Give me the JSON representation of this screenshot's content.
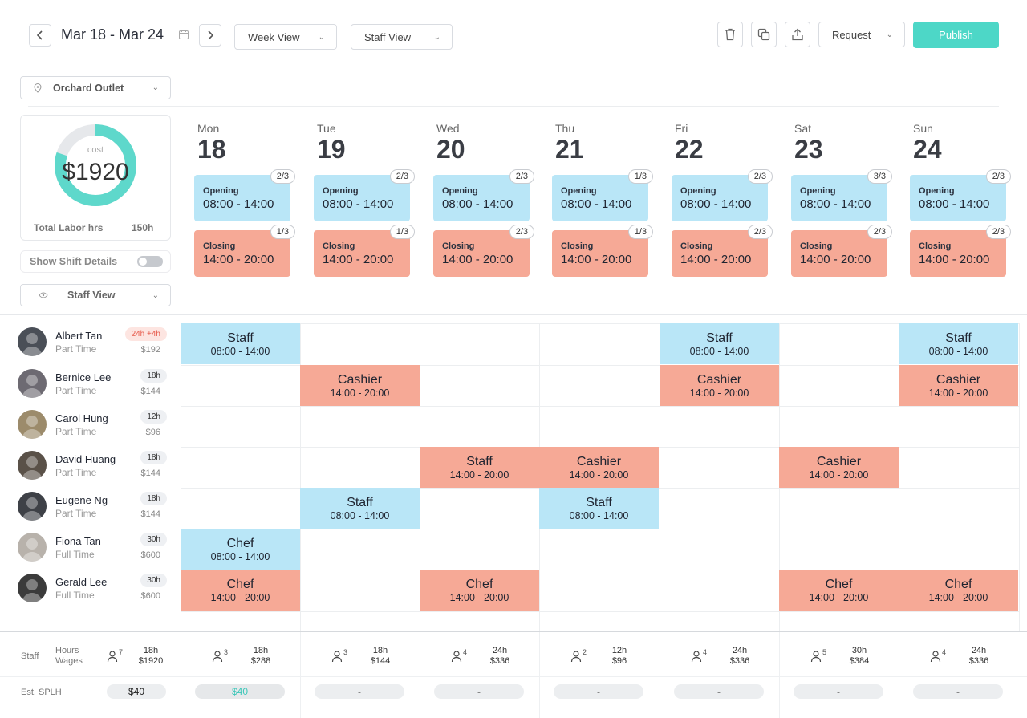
{
  "toolbar": {
    "date_range": "Mar 18 - Mar 24",
    "view_select": "Week View",
    "mode_select": "Staff View",
    "request_label": "Request",
    "publish_label": "Publish",
    "icons": [
      "chevron-left-icon",
      "chevron-right-icon",
      "calendar-icon",
      "trash-icon",
      "copy-icon",
      "share-icon"
    ]
  },
  "location": "Orchard Outlet",
  "summary": {
    "cost_label": "cost",
    "cost_value": "$1920",
    "cost_ring_fraction": 0.8,
    "total_hrs_label": "Total Labor hrs",
    "total_hrs_value": "150h",
    "toggle_label": "Show Shift Details",
    "toggle_on": false,
    "view_select": "Staff View"
  },
  "colors": {
    "opening": "#b9e6f7",
    "closing": "#f6a996",
    "accent": "#4dd7c7",
    "warn": "#e65a4b"
  },
  "days": [
    {
      "name": "Mon",
      "num": "18",
      "open_badge": "2/3",
      "close_badge": "1/3"
    },
    {
      "name": "Tue",
      "num": "19",
      "open_badge": "2/3",
      "close_badge": "1/3"
    },
    {
      "name": "Wed",
      "num": "20",
      "open_badge": "2/3",
      "close_badge": "2/3"
    },
    {
      "name": "Thu",
      "num": "21",
      "open_badge": "1/3",
      "close_badge": "1/3"
    },
    {
      "name": "Fri",
      "num": "22",
      "open_badge": "2/3",
      "close_badge": "2/3"
    },
    {
      "name": "Sat",
      "num": "23",
      "open_badge": "3/3",
      "close_badge": "2/3"
    },
    {
      "name": "Sun",
      "num": "24",
      "open_badge": "2/3",
      "close_badge": "2/3"
    }
  ],
  "shift_types": {
    "opening": {
      "label": "Opening",
      "time": "08:00 - 14:00"
    },
    "closing": {
      "label": "Closing",
      "time": "14:00 - 20:00"
    }
  },
  "employees": [
    {
      "name": "Albert Tan",
      "type": "Part Time",
      "hours": "24h +4h",
      "wage": "$192",
      "warn": true
    },
    {
      "name": "Bernice Lee",
      "type": "Part Time",
      "hours": "18h",
      "wage": "$144"
    },
    {
      "name": "Carol Hung",
      "type": "Part Time",
      "hours": "12h",
      "wage": "$96"
    },
    {
      "name": "David Huang",
      "type": "Part Time",
      "hours": "18h",
      "wage": "$144"
    },
    {
      "name": "Eugene Ng",
      "type": "Part Time",
      "hours": "18h",
      "wage": "$144"
    },
    {
      "name": "Fiona Tan",
      "type": "Full Time",
      "hours": "30h",
      "wage": "$600"
    },
    {
      "name": "Gerald Lee",
      "type": "Full Time",
      "hours": "30h",
      "wage": "$600"
    }
  ],
  "assignments": [
    {
      "emp": 0,
      "day": 0,
      "role": "Staff",
      "time": "08:00 - 14:00",
      "kind": "o"
    },
    {
      "emp": 0,
      "day": 4,
      "role": "Staff",
      "time": "08:00 - 14:00",
      "kind": "o"
    },
    {
      "emp": 0,
      "day": 6,
      "role": "Staff",
      "time": "08:00 - 14:00",
      "kind": "o"
    },
    {
      "emp": 1,
      "day": 1,
      "role": "Cashier",
      "time": "14:00 - 20:00",
      "kind": "c"
    },
    {
      "emp": 1,
      "day": 4,
      "role": "Cashier",
      "time": "14:00 - 20:00",
      "kind": "c"
    },
    {
      "emp": 1,
      "day": 6,
      "role": "Cashier",
      "time": "14:00 - 20:00",
      "kind": "c"
    },
    {
      "emp": 3,
      "day": 2,
      "role": "Staff",
      "time": "14:00 - 20:00",
      "kind": "c"
    },
    {
      "emp": 3,
      "day": 3,
      "role": "Cashier",
      "time": "14:00 - 20:00",
      "kind": "c"
    },
    {
      "emp": 3,
      "day": 5,
      "role": "Cashier",
      "time": "14:00 - 20:00",
      "kind": "c"
    },
    {
      "emp": 4,
      "day": 1,
      "role": "Staff",
      "time": "08:00 - 14:00",
      "kind": "o"
    },
    {
      "emp": 4,
      "day": 3,
      "role": "Staff",
      "time": "08:00 - 14:00",
      "kind": "o"
    },
    {
      "emp": 5,
      "day": 0,
      "role": "Chef",
      "time": "08:00 - 14:00",
      "kind": "o"
    },
    {
      "emp": 6,
      "day": 0,
      "role": "Chef",
      "time": "14:00 - 20:00",
      "kind": "c"
    },
    {
      "emp": 6,
      "day": 2,
      "role": "Chef",
      "time": "14:00 - 20:00",
      "kind": "c"
    },
    {
      "emp": 6,
      "day": 5,
      "role": "Chef",
      "time": "14:00 - 20:00",
      "kind": "c"
    },
    {
      "emp": 6,
      "day": 6,
      "role": "Chef",
      "time": "14:00 - 20:00",
      "kind": "c"
    }
  ],
  "footer": {
    "staff_label": "Staff",
    "hours_label": "Hours",
    "wages_label": "Wages",
    "total": {
      "staff": "7",
      "hours": "18h",
      "wages": "$1920"
    },
    "days": [
      {
        "staff": "3",
        "hours": "18h",
        "wages": "$288"
      },
      {
        "staff": "3",
        "hours": "18h",
        "wages": "$144"
      },
      {
        "staff": "4",
        "hours": "24h",
        "wages": "$336"
      },
      {
        "staff": "2",
        "hours": "12h",
        "wages": "$96"
      },
      {
        "staff": "4",
        "hours": "24h",
        "wages": "$336"
      },
      {
        "staff": "5",
        "hours": "30h",
        "wages": "$384"
      },
      {
        "staff": "4",
        "hours": "24h",
        "wages": "$336"
      }
    ],
    "splh_label": "Est. SPLH",
    "splh_total": "$40",
    "splh_days": [
      "$40",
      "-",
      "-",
      "-",
      "-",
      "-",
      "-"
    ]
  }
}
